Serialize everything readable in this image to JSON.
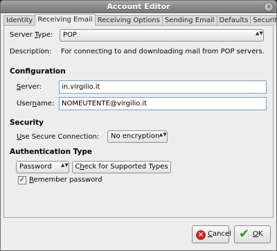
{
  "window": {
    "title": "Account Editor",
    "close_glyph": "×"
  },
  "tabs": [
    {
      "label": "Identity"
    },
    {
      "label": "Receiving Email"
    },
    {
      "label": "Receiving Options"
    },
    {
      "label": "Sending Email"
    },
    {
      "label": "Defaults"
    },
    {
      "label": "Security"
    }
  ],
  "server_type": {
    "label_pre": "Server ",
    "label_u": "T",
    "label_post": "ype:",
    "value": "POP"
  },
  "description": {
    "label": "Description:",
    "value": "For connecting to and downloading mail from POP servers."
  },
  "configuration": {
    "heading": "Configuration",
    "server_label_u": "S",
    "server_label_post": "erver:",
    "server_value": "in.virgilio.it",
    "username_label_pre": "User",
    "username_label_u": "n",
    "username_label_post": "ame:",
    "username_value": "NOMEUTENTE@virgilio.it"
  },
  "security": {
    "heading": "Security",
    "secure_label_u": "U",
    "secure_label_post": "se Secure Connection:",
    "secure_value": "No encryption"
  },
  "authentication": {
    "heading": "Authentication Type",
    "type_value": "Password",
    "check_label_pre": "C",
    "check_label_u": "h",
    "check_label_post": "eck for Supported Types",
    "remember_label_u": "R",
    "remember_label_post": "emember password",
    "remember_checked": true,
    "check_glyph": "✓"
  },
  "buttons": {
    "cancel_u": "C",
    "cancel_post": "ancel",
    "cancel_icon_glyph": "×",
    "ok_u": "O",
    "ok_post": "K",
    "ok_icon_glyph": "✔"
  },
  "icons": {
    "combo_arrows": "▲▼",
    "cancel": "cancel-icon",
    "ok": "ok-check-icon"
  }
}
